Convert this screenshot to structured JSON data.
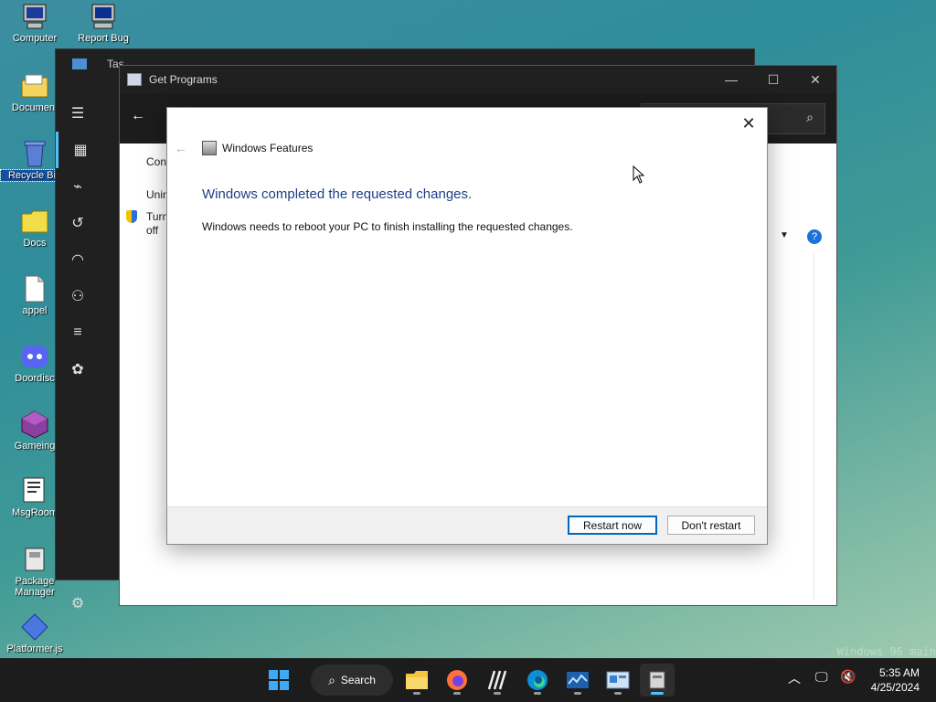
{
  "desktop": {
    "icons": [
      {
        "label": "Computer"
      },
      {
        "label": "Report Bug"
      },
      {
        "label": "Document"
      },
      {
        "label": "Recycle Bin"
      },
      {
        "label": "Docs"
      },
      {
        "label": "appel"
      },
      {
        "label": "Doordisc"
      },
      {
        "label": "Gameing"
      },
      {
        "label": "MsgRoom"
      },
      {
        "label": "Package Manager"
      },
      {
        "label": "Platformer.js"
      }
    ],
    "watermark": "Windows 96 main"
  },
  "task_manager": {
    "title": "Tas"
  },
  "get_programs": {
    "title": "Get Programs",
    "side_items": [
      "Cont",
      "Unin",
      "Turn",
      "off"
    ]
  },
  "dialog": {
    "header_title": "Windows Features",
    "heading": "Windows completed the requested changes.",
    "message": "Windows needs to reboot your PC to finish installing the requested changes.",
    "restart_label": "Restart now",
    "dont_restart_label": "Don't restart"
  },
  "taskbar": {
    "search_label": "Search",
    "time": "5:35 AM",
    "date": "4/25/2024"
  },
  "colors": {
    "accent": "#0067c0",
    "heading_blue": "#1f3f87"
  }
}
